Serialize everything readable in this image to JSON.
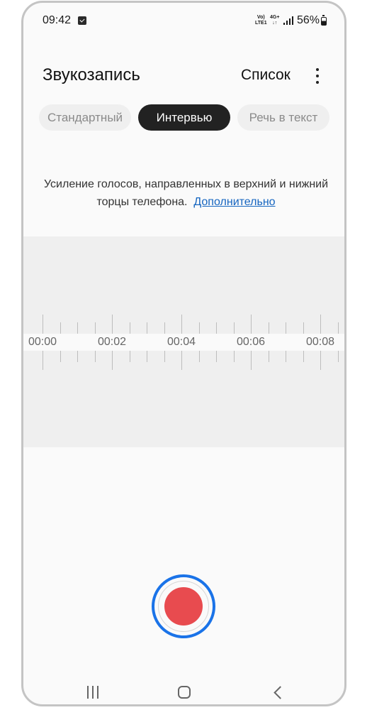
{
  "status_bar": {
    "time": "09:42",
    "battery": "56%",
    "net_top": "Vo)",
    "net_bottom": "LTE1",
    "net2_top": "4G+",
    "net2_bottom": "↓↑",
    "icons": [
      "message-icon",
      "volte-icon",
      "4g-icon",
      "signal-icon",
      "battery-icon"
    ]
  },
  "header": {
    "title": "Звукозапись",
    "list_label": "Список",
    "more_icon": "more-vertical-icon"
  },
  "tabs": [
    {
      "label": "Стандартный",
      "selected": false
    },
    {
      "label": "Интервью",
      "selected": true
    },
    {
      "label": "Речь в текст",
      "selected": false
    }
  ],
  "description": {
    "text": "Усиление голосов, направленных в верхний и нижний торцы телефона.",
    "link": "Дополнительно"
  },
  "timeline": {
    "labels": [
      "00:00",
      "00:02",
      "00:04",
      "00:06",
      "00:08"
    ]
  },
  "colors": {
    "accent_ring": "#1a73e8",
    "record": "#e84b4f",
    "selected_tab": "#222222",
    "link": "#1565c0"
  },
  "navbar": {
    "icons": [
      "recents-icon",
      "home-icon",
      "back-icon"
    ]
  }
}
